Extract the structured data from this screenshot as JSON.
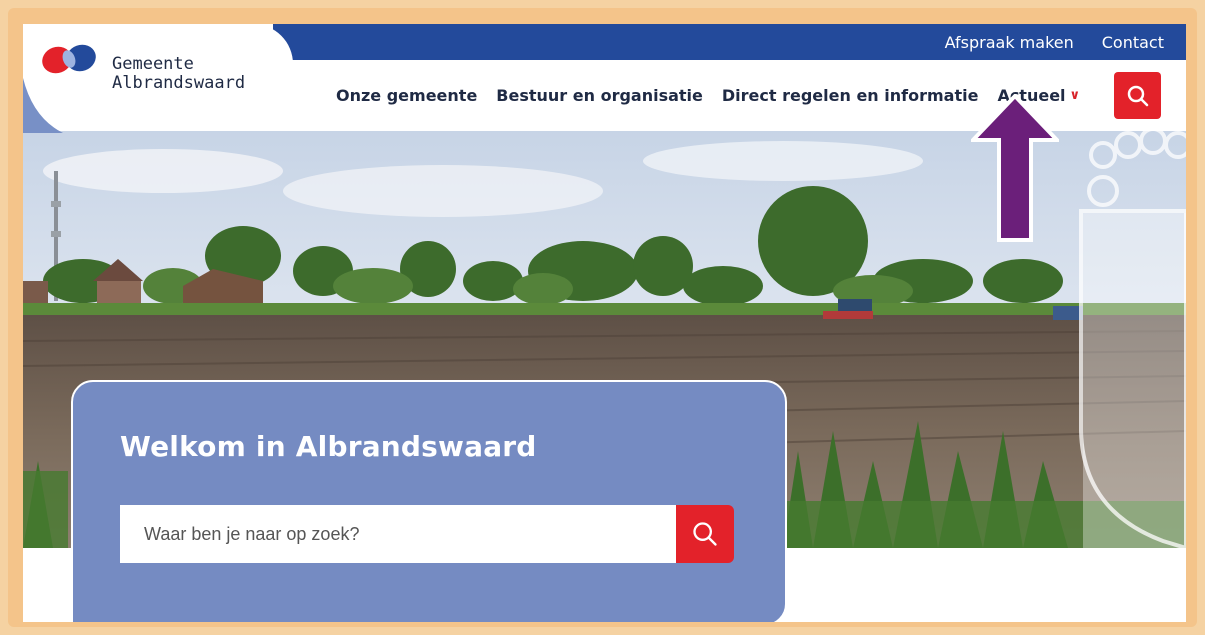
{
  "brand": {
    "name_line1": "Gemeente",
    "name_line2": "Albrandswaard",
    "colors": {
      "blue": "#234a9b",
      "red": "#e3222a",
      "card": "#758bc2"
    }
  },
  "topbar": {
    "links": [
      "Afspraak maken",
      "Contact"
    ]
  },
  "nav": {
    "items": [
      "Onze gemeente",
      "Bestuur en organisatie",
      "Direct regelen en informatie",
      "Actueel"
    ],
    "search_icon": "search-icon"
  },
  "welcome": {
    "title": "Welkom in Albrandswaard",
    "search_placeholder": "Waar ben je naar op zoek?",
    "search_icon": "search-icon"
  },
  "annotation": {
    "icon": "arrow-up-icon",
    "color": "#6b1f7a"
  }
}
